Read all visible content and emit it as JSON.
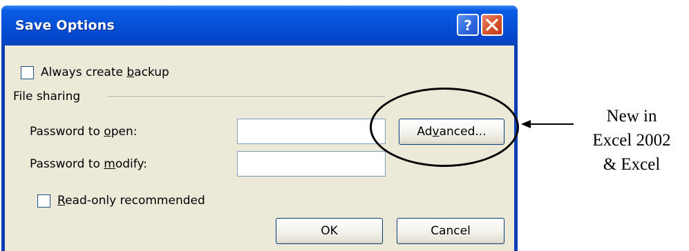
{
  "dialog": {
    "title": "Save Options",
    "help_icon": "question-mark-icon",
    "close_icon": "close-x-icon"
  },
  "backup": {
    "label_pre": "Always create ",
    "label_mnemonic": "b",
    "label_post": "ackup",
    "checked": false
  },
  "file_sharing": {
    "group_label": "File sharing",
    "open_label_pre": "Password to ",
    "open_label_mnemonic": "o",
    "open_label_post": "pen:",
    "open_value": "",
    "modify_label_pre": "Password to ",
    "modify_label_mnemonic": "m",
    "modify_label_post": "odify:",
    "modify_value": "",
    "advanced_pre": "Ad",
    "advanced_mnemonic": "v",
    "advanced_post": "anced...",
    "readonly_label_pre": "",
    "readonly_label_mnemonic": "R",
    "readonly_label_post": "ead-only recommended",
    "readonly_checked": false
  },
  "buttons": {
    "ok": "OK",
    "cancel": "Cancel"
  },
  "annotation": {
    "lines": [
      "New in",
      "Excel 2002",
      "& Excel"
    ]
  },
  "colors": {
    "titlebar_blue": "#0652d8",
    "dialog_face": "#ece9d8",
    "close_red": "#d6522d"
  }
}
